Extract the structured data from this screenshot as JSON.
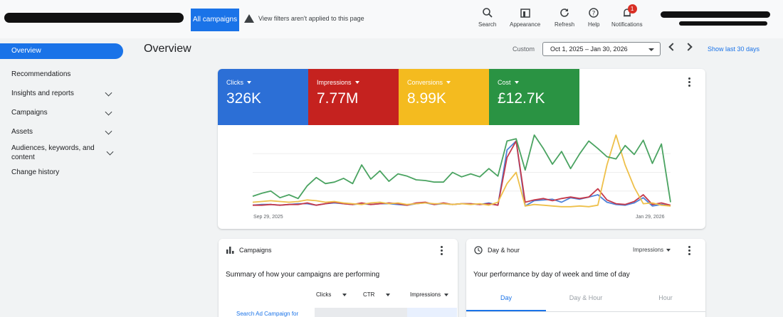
{
  "topbar": {
    "all_campaigns_label": "All campaigns",
    "filter_warning": "View filters aren't applied to this page",
    "tools": [
      {
        "label": "Search",
        "icon": "search-icon"
      },
      {
        "label": "Appearance",
        "icon": "appearance-icon"
      },
      {
        "label": "Refresh",
        "icon": "refresh-icon"
      },
      {
        "label": "Help",
        "icon": "help-icon"
      },
      {
        "label": "Notifications",
        "icon": "bell-icon",
        "badge": "1"
      }
    ]
  },
  "sidebar": {
    "items": [
      {
        "label": "Overview",
        "active": true
      },
      {
        "label": "Recommendations"
      },
      {
        "label": "Insights and reports",
        "expandable": true
      },
      {
        "label": "Campaigns",
        "expandable": true
      },
      {
        "label": "Assets",
        "expandable": true
      },
      {
        "label": "Audiences, keywords, and content",
        "expandable": true
      },
      {
        "label": "Change history"
      }
    ]
  },
  "header": {
    "title": "Overview",
    "custom_label": "Custom",
    "date_range": "Oct 1, 2025 – Jan 30, 2026",
    "show_last": "Show last 30 days"
  },
  "metrics": [
    {
      "label": "Clicks",
      "value": "326K",
      "color": "#2c6fd6"
    },
    {
      "label": "Impressions",
      "value": "7.77M",
      "color": "#c5221f"
    },
    {
      "label": "Conversions",
      "value": "8.99K",
      "color": "#f4bb1f"
    },
    {
      "label": "Cost",
      "value": "£12.7K",
      "color": "#2a9343"
    }
  ],
  "chart": {
    "x_start_label": "Sep 29, 2025",
    "x_end_label": "Jan 29, 2026"
  },
  "chart_data": {
    "type": "line",
    "x_range": [
      "Sep 29, 2025",
      "Jan 29, 2026"
    ],
    "grid": true,
    "legend": "metric tiles above the chart",
    "series": [
      {
        "name": "Clicks",
        "color": "#4e83d8",
        "values": [
          0.06,
          0.07,
          0.07,
          0.06,
          0.07,
          0.08,
          0.08,
          0.06,
          0.08,
          0.09,
          0.08,
          0.07,
          0.08,
          0.07,
          0.08,
          0.08,
          0.07,
          0.06,
          0.08,
          0.09,
          0.07,
          0.08,
          0.07,
          0.08,
          0.08,
          0.07,
          0.09,
          0.06,
          0.8,
          0.92,
          0.05,
          0.12,
          0.13,
          0.14,
          0.1,
          0.16,
          0.14,
          0.17,
          0.2,
          0.1,
          0.07,
          0.06,
          0.09,
          0.16,
          0.05,
          0.07,
          0.05
        ]
      },
      {
        "name": "Impressions",
        "color": "#c5384a",
        "values": [
          0.06,
          0.06,
          0.07,
          0.06,
          0.07,
          0.07,
          0.09,
          0.06,
          0.08,
          0.1,
          0.08,
          0.07,
          0.09,
          0.07,
          0.08,
          0.09,
          0.08,
          0.06,
          0.09,
          0.1,
          0.07,
          0.09,
          0.07,
          0.08,
          0.08,
          0.07,
          0.08,
          0.06,
          0.7,
          0.92,
          0.1,
          0.13,
          0.15,
          0.12,
          0.15,
          0.17,
          0.15,
          0.17,
          0.28,
          0.13,
          0.08,
          0.07,
          0.11,
          0.2,
          0.07,
          0.09,
          0.06
        ]
      },
      {
        "name": "Conversions",
        "color": "#eec04a",
        "values": [
          0.1,
          0.11,
          0.12,
          0.11,
          0.1,
          0.11,
          0.13,
          0.12,
          0.1,
          0.11,
          0.09,
          0.08,
          0.07,
          0.09,
          0.1,
          0.08,
          0.09,
          0.07,
          0.08,
          0.09,
          0.08,
          0.08,
          0.07,
          0.08,
          0.07,
          0.08,
          0.06,
          0.1,
          0.35,
          0.5,
          0.05,
          0.07,
          0.06,
          0.05,
          0.04,
          0.04,
          0.05,
          0.04,
          0.06,
          0.6,
          1.0,
          0.6,
          0.3,
          0.08,
          0.09,
          0.06,
          0.05
        ]
      },
      {
        "name": "Cost",
        "color": "#4aa361",
        "values": [
          0.18,
          0.22,
          0.25,
          0.16,
          0.2,
          0.15,
          0.32,
          0.43,
          0.35,
          0.37,
          0.42,
          0.35,
          0.6,
          0.41,
          0.52,
          0.38,
          0.48,
          0.45,
          0.4,
          0.39,
          0.37,
          0.37,
          0.5,
          0.44,
          0.48,
          0.44,
          0.55,
          0.45,
          0.92,
          0.95,
          0.53,
          1.0,
          0.82,
          0.61,
          0.78,
          0.55,
          0.75,
          0.92,
          0.82,
          0.71,
          0.68,
          0.86,
          0.74,
          0.93,
          0.62,
          0.88,
          0.1
        ]
      }
    ]
  },
  "campaigns_card": {
    "title": "Campaigns",
    "description": "Summary of how your campaigns are performing",
    "columns": [
      "Clicks",
      "CTR",
      "Impressions"
    ],
    "first_row": "Search Ad Campaign for"
  },
  "dayhour_card": {
    "title": "Day & hour",
    "metric_select": "Impressions",
    "description": "Your performance by day of week and time of day",
    "tabs": [
      "Day",
      "Day & Hour",
      "Hour"
    ]
  }
}
